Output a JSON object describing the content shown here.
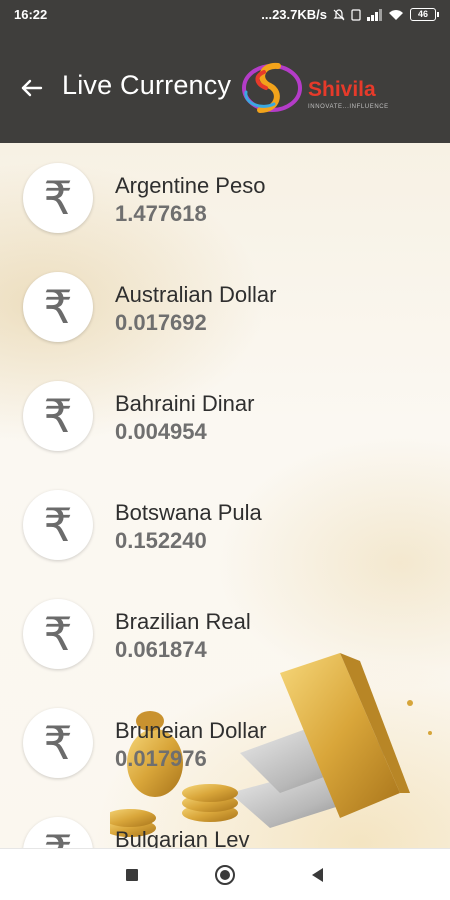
{
  "status_bar": {
    "time": "16:22",
    "network_speed": "...23.7KB/s",
    "battery": "46"
  },
  "app_bar": {
    "title": "Live Currency",
    "logo": {
      "brand": "Shivila",
      "tagline": "INNOVATE...INFLUENCE"
    }
  },
  "icons": {
    "back": "arrow-left-icon",
    "currency": "rupee-icon",
    "nav_recent": "square-icon",
    "nav_home": "circle-icon",
    "nav_back": "triangle-left-icon"
  },
  "currencies": [
    {
      "name": "Argentine Peso",
      "rate": "1.477618"
    },
    {
      "name": "Australian Dollar",
      "rate": "0.017692"
    },
    {
      "name": "Bahraini Dinar",
      "rate": "0.004954"
    },
    {
      "name": "Botswana Pula",
      "rate": "0.152240"
    },
    {
      "name": "Brazilian Real",
      "rate": "0.061874"
    },
    {
      "name": "Bruneian Dollar",
      "rate": "0.017976"
    },
    {
      "name": "Bulgarian Lev",
      "rate": ""
    }
  ],
  "colors": {
    "app_bar_bg": "#3f3e3c",
    "brand_red": "#e63a2a",
    "rate_text": "#6f6f6f"
  }
}
